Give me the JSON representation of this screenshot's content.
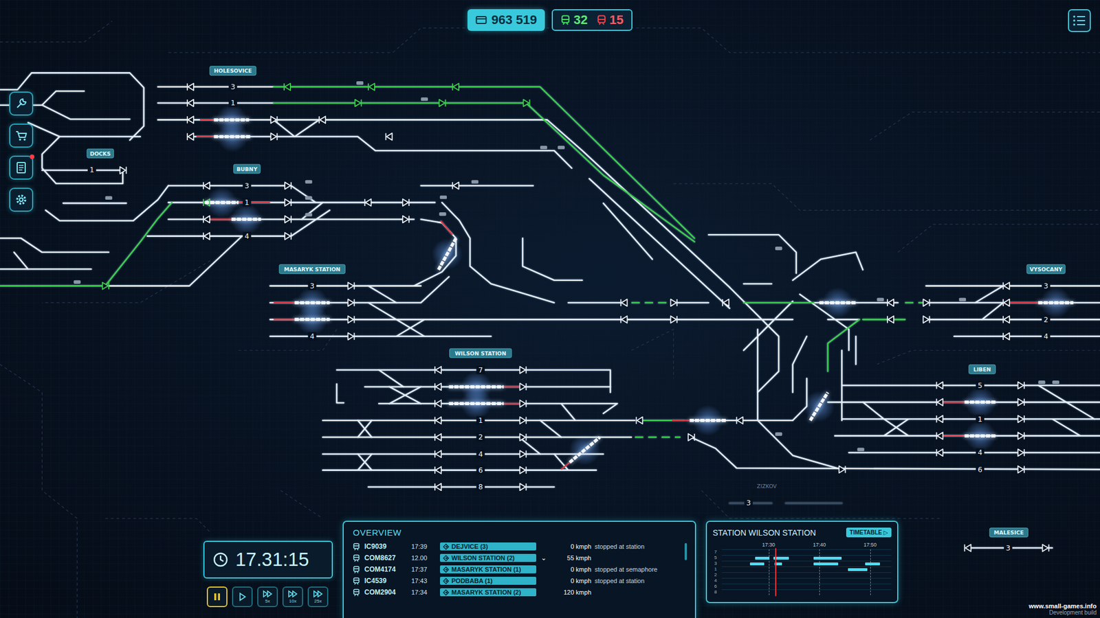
{
  "hud": {
    "money": "963 519",
    "trains_on_time": "32",
    "trains_delayed": "15"
  },
  "sidebar": {
    "items": [
      {
        "kind": "tools",
        "notification": false
      },
      {
        "kind": "shop",
        "notification": false
      },
      {
        "kind": "book",
        "notification": true
      },
      {
        "kind": "settings",
        "notification": false
      }
    ]
  },
  "stations": [
    {
      "name": "HOLESOVICE",
      "boxed": true,
      "tracks": [
        "3",
        "1"
      ]
    },
    {
      "name": "DOCKS",
      "boxed": true,
      "tracks": [
        "1"
      ]
    },
    {
      "name": "BUBNY",
      "boxed": true,
      "tracks": [
        "3",
        "1",
        "4"
      ]
    },
    {
      "name": "MASARYK STATION",
      "boxed": true,
      "tracks": [
        "3",
        "4"
      ]
    },
    {
      "name": "WILSON STATION",
      "boxed": true,
      "tracks": [
        "7",
        "1",
        "2",
        "4",
        "6",
        "8"
      ]
    },
    {
      "name": "VYSOCANY",
      "boxed": true,
      "tracks": [
        "3",
        "2",
        "4"
      ]
    },
    {
      "name": "LIBEN",
      "boxed": true,
      "tracks": [
        "5",
        "1",
        "4",
        "6"
      ]
    },
    {
      "name": "ZIZKOV",
      "boxed": false,
      "tracks": [
        "3"
      ]
    },
    {
      "name": "MALESICE",
      "boxed": true,
      "tracks": [
        "3"
      ]
    }
  ],
  "clock": {
    "time": "17.31:15"
  },
  "speed_controls": [
    {
      "kind": "pause",
      "label": "",
      "selected": true
    },
    {
      "kind": "play",
      "label": "",
      "selected": false
    },
    {
      "kind": "fast",
      "label": "5x",
      "selected": false
    },
    {
      "kind": "fast",
      "label": "10x",
      "selected": false
    },
    {
      "kind": "fast",
      "label": "25x",
      "selected": false
    }
  ],
  "overview": {
    "title": "OVERVIEW",
    "rows": [
      {
        "id": "IC9039",
        "time": "17:39",
        "destination": "DEJVICE (3)",
        "marker": "",
        "speed": "0 kmph",
        "status": "stopped at station"
      },
      {
        "id": "COM8627",
        "time": "12.00",
        "destination": "WILSON STATION (2)",
        "marker": "⌄",
        "speed": "55 kmph",
        "status": ""
      },
      {
        "id": "COM4174",
        "time": "17:37",
        "destination": "MASARYK STATION (1)",
        "marker": "",
        "speed": "0 kmph",
        "status": "stopped at semaphore"
      },
      {
        "id": "IC4539",
        "time": "17:43",
        "destination": "PODBABA (1)",
        "marker": "",
        "speed": "0 kmph",
        "status": "stopped at station"
      },
      {
        "id": "COM2904",
        "time": "17:34",
        "destination": "MASARYK STATION (2)",
        "marker": "",
        "speed": "120 kmph",
        "status": ""
      }
    ]
  },
  "station_panel": {
    "title": "STATION WILSON STATION",
    "button": "TIMETABLE",
    "button_icon": "▷",
    "ticks": [
      "17:30",
      "17:40",
      "17:50"
    ],
    "tracks": [
      "7",
      "5",
      "3",
      "1",
      "2",
      "4",
      "6",
      "8"
    ],
    "now": 31.25,
    "occupancy": [
      {
        "track": "5",
        "from": 27.4,
        "to": 30.2
      },
      {
        "track": "5",
        "from": 30.9,
        "to": 34
      },
      {
        "track": "5",
        "from": 38.8,
        "to": 44.4
      },
      {
        "track": "3",
        "from": 26.3,
        "to": 29.1
      },
      {
        "track": "3",
        "from": 31.2,
        "to": 32.6
      },
      {
        "track": "3",
        "from": 38.8,
        "to": 43.7
      },
      {
        "track": "3",
        "from": 49,
        "to": 52
      },
      {
        "track": "1",
        "from": 45.6,
        "to": 49.5
      }
    ]
  },
  "watermark": {
    "site": "www.small-games.info",
    "build": "Development build"
  }
}
